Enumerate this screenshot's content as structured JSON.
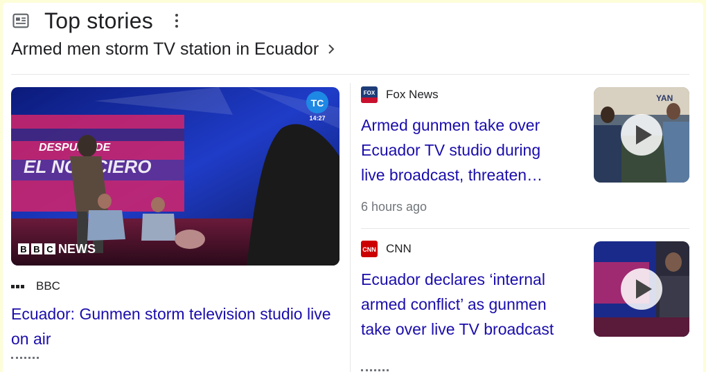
{
  "header": {
    "title": "Top stories",
    "icon": "newspaper-icon",
    "menu_icon": "more-vert-icon"
  },
  "topic": {
    "label": "Armed men storm TV station in Ecuador",
    "icon": "chevron-right-icon"
  },
  "stories": [
    {
      "source": "BBC",
      "headline": "Ecuador: Gunmen storm television studio live on air",
      "image_overlay": {
        "channel_badge": "TC",
        "clock": "14:27",
        "set_text": "DESPUÉS DE EL NOTICIERO",
        "broadcaster": "BBC NEWS"
      }
    },
    {
      "source": "Fox News",
      "headline": "Armed gunmen take over Ecuador TV studio during live broadcast, threaten…",
      "time": "6 hours ago",
      "thumbnail_icon": "play-icon"
    },
    {
      "source": "CNN",
      "headline": "Ecuador declares ‘internal armed conflict’ as gunmen take over live TV broadcast",
      "thumbnail_icon": "play-icon"
    }
  ],
  "colors": {
    "link": "#1a0dab",
    "text": "#202124",
    "muted": "#70757a",
    "frame": "#fdfdd8"
  }
}
